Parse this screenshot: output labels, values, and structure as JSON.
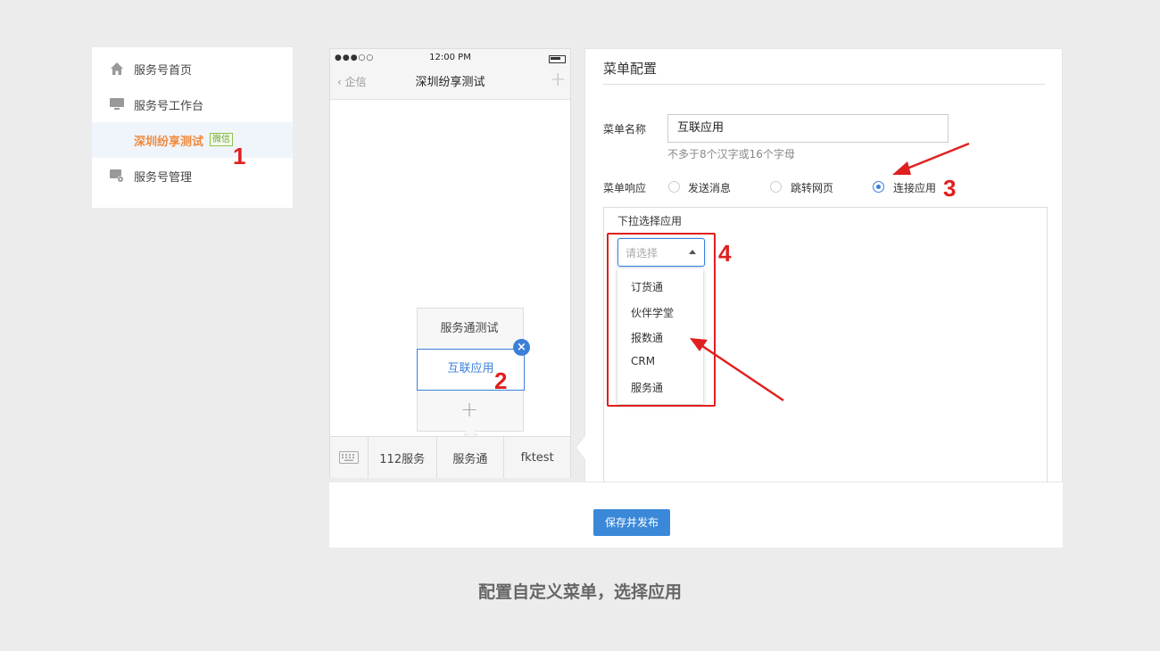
{
  "sidebar": {
    "items": [
      {
        "label": "服务号首页",
        "icon": "home-icon"
      },
      {
        "label": "服务号工作台",
        "icon": "monitor-icon"
      },
      {
        "label": "深圳纷享测试",
        "badge": "微信",
        "active": true
      },
      {
        "label": "服务号管理",
        "icon": "manage-gear-icon"
      }
    ]
  },
  "phone": {
    "signal": "●●●○○",
    "time": "12:00 PM",
    "back": "企信",
    "title": "深圳纷享测试",
    "plus": "+",
    "submenu": [
      "服务通测试",
      "互联应用"
    ],
    "close": "×",
    "add": "+",
    "bottom_tabs": [
      "112服务",
      "服务通",
      "fktest"
    ]
  },
  "config": {
    "title": "菜单配置",
    "name_label": "菜单名称",
    "name_value": "互联应用",
    "name_hint": "不多于8个汉字或16个字母",
    "response_label": "菜单响应",
    "responses": [
      {
        "label": "发送消息",
        "selected": false
      },
      {
        "label": "跳转网页",
        "selected": false
      },
      {
        "label": "连接应用",
        "selected": true
      }
    ],
    "app_box_title": "下拉选择应用",
    "select_placeholder": "请选择",
    "apps": [
      "订货通",
      "伙伴学堂",
      "报数通",
      "CRM",
      "服务通"
    ],
    "save_button": "保存并发布"
  },
  "annotations": [
    "1",
    "2",
    "3",
    "4"
  ],
  "caption": "配置自定义菜单，选择应用",
  "colors": {
    "accent": "#3b7fd8",
    "highlight": "#f08a3c",
    "annotation_red": "#e01f1f"
  }
}
